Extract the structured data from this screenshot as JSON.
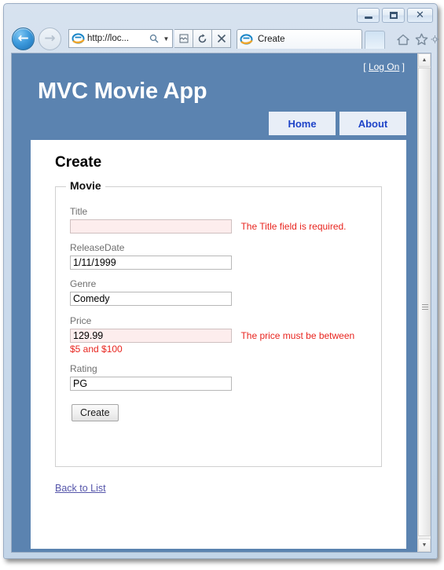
{
  "browser": {
    "window_controls": {
      "minimize": "minimize-button",
      "maximize": "maximize-button",
      "close": "close-button",
      "close_glyph": "✕"
    },
    "back_glyph": "←",
    "forward_glyph": "→",
    "address": {
      "url_text": "http://loc...",
      "search_glyph": "⚲",
      "dropdown_glyph": "▼"
    },
    "toolbar_buttons": [
      {
        "name": "compatibility-view-button",
        "glyph": "☰"
      },
      {
        "name": "refresh-button",
        "glyph": "⟳"
      },
      {
        "name": "stop-button",
        "glyph": "✕"
      }
    ],
    "tab": {
      "label": "Create"
    },
    "new_tab_label": "",
    "right_icons": [
      {
        "name": "home-icon",
        "glyph": "⌂"
      },
      {
        "name": "favorites-icon",
        "glyph": "☆"
      },
      {
        "name": "tools-icon",
        "glyph": "⚙"
      }
    ],
    "scrollbar": {
      "up_glyph": "▲",
      "down_glyph": "▼"
    }
  },
  "site": {
    "title": "MVC Movie App",
    "logon_prefix": "[ ",
    "logon_label": "Log On",
    "logon_suffix": " ]",
    "menu": [
      {
        "label": "Home"
      },
      {
        "label": "About"
      }
    ]
  },
  "page": {
    "heading": "Create",
    "fieldset_legend": "Movie",
    "fields": [
      {
        "label": "Title",
        "value": "",
        "error": "The Title field is required.",
        "error_wrapped": "",
        "has_error": true
      },
      {
        "label": "ReleaseDate",
        "value": "1/11/1999",
        "error": "",
        "error_wrapped": "",
        "has_error": false
      },
      {
        "label": "Genre",
        "value": "Comedy",
        "error": "",
        "error_wrapped": "",
        "has_error": false
      },
      {
        "label": "Price",
        "value": "129.99",
        "error": "The price must be between",
        "error_wrapped": "$5 and $100",
        "has_error": true
      },
      {
        "label": "Rating",
        "value": "PG",
        "error": "",
        "error_wrapped": "",
        "has_error": false
      }
    ],
    "submit_label": "Create",
    "back_link_label": "Back to List"
  },
  "colors": {
    "page_background": "#5b83b0",
    "menu_text": "#1f44c8",
    "error_text": "#e8251f",
    "error_input_background": "#fdeded",
    "link": "#5555aa"
  }
}
